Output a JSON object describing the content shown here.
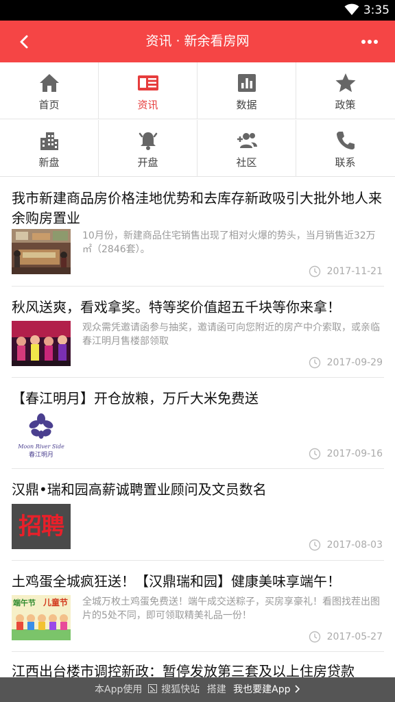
{
  "status": {
    "time": "3:35"
  },
  "header": {
    "title": "资讯 · 新余看房网"
  },
  "nav": [
    {
      "label": "首页",
      "icon": "home-icon"
    },
    {
      "label": "资讯",
      "icon": "news-icon",
      "active": true
    },
    {
      "label": "数据",
      "icon": "bar-chart-icon"
    },
    {
      "label": "政策",
      "icon": "star-icon"
    },
    {
      "label": "新盘",
      "icon": "building-icon"
    },
    {
      "label": "开盘",
      "icon": "bell-icon"
    },
    {
      "label": "社区",
      "icon": "add-group-icon"
    },
    {
      "label": "联系",
      "icon": "phone-icon"
    }
  ],
  "articles": [
    {
      "title": "我市新建商品房价格洼地优势和去库存新政吸引大批外地人来余购房置业",
      "summary": "10月份，新建商品住宅销售出现了相对火爆的势头，当月销售近32万㎡（2846套）。",
      "date": "2017-11-21",
      "thumb": "photo"
    },
    {
      "title": "秋风送爽，看戏拿奖。特等奖价值超五千块等你来拿！",
      "summary": "观众需凭邀请函参与抽奖，邀请函可向您附近的房产中介索取，或亲临春江明月售楼部领取",
      "date": "2017-09-29",
      "thumb": "stage"
    },
    {
      "title": "【春江明月】开仓放粮，万斤大米免费送",
      "summary": "",
      "date": "2017-09-16",
      "thumb": "logo",
      "logo_en": "Moon River Side",
      "logo_cn": "春江明月"
    },
    {
      "title": "汉鼎•瑞和园高薪诚聘置业顾问及文员数名",
      "summary": "",
      "date": "2017-08-03",
      "thumb": "recruit",
      "thumb_text": "招聘"
    },
    {
      "title": "土鸡蛋全城疯狂送！【汉鼎瑞和园】健康美味享端午！",
      "summary": "全城万枚土鸡蛋免费送！端午成交送粽子，买房享豪礼！看图找茬出图片的5处不同，即可领取精美礼品一份！",
      "date": "2017-05-27",
      "thumb": "festival",
      "thumb_text_a": "端午节",
      "thumb_text_b": "儿童节"
    },
    {
      "title": "江西出台楼市调控新政：暂停发放第三套及以上住房贷款",
      "summary": "",
      "date": "",
      "thumb": ""
    }
  ],
  "footer": {
    "prefix": "本App使用",
    "brand": "搜狐快站",
    "mid": "搭建",
    "cta": "我也要建App"
  }
}
